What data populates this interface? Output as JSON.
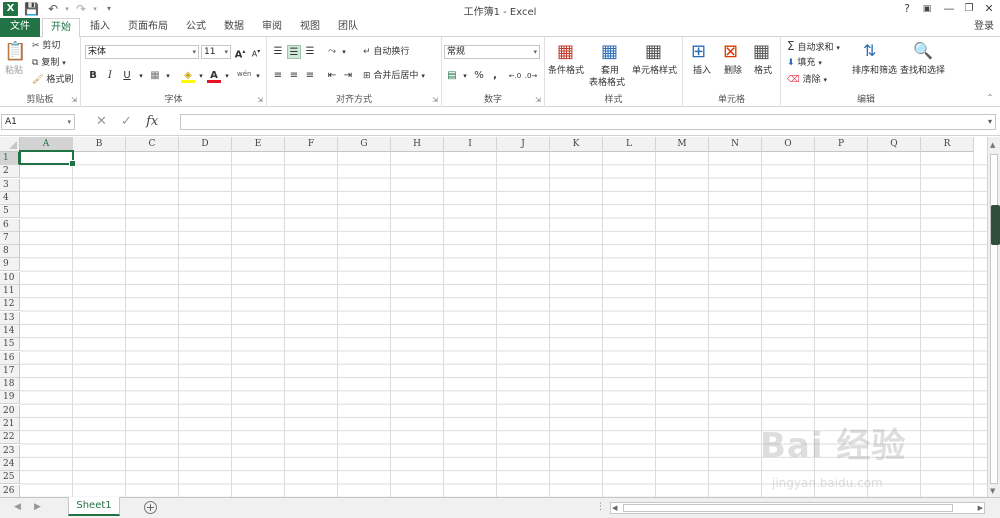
{
  "window": {
    "title": "工作簿1 - Excel",
    "help": "?",
    "login": "登录"
  },
  "tabs": [
    "文件",
    "开始",
    "插入",
    "页面布局",
    "公式",
    "数据",
    "审阅",
    "视图",
    "团队"
  ],
  "clipboard": {
    "paste": "粘贴",
    "cut": "剪切",
    "copy": "复制",
    "format_painter": "格式刷",
    "label": "剪贴板"
  },
  "font": {
    "name": "宋体",
    "size": "11",
    "bold": "B",
    "italic": "I",
    "underline": "U",
    "grow": "A",
    "shrink": "A",
    "color_letter": "A",
    "wen": "wén",
    "label": "字体"
  },
  "alignment": {
    "wrap": "自动换行",
    "merge": "合并后居中",
    "label": "对齐方式"
  },
  "number": {
    "format": "常规",
    "percent": "%",
    "comma": ",",
    "label": "数字"
  },
  "styles": {
    "conditional": "条件格式",
    "table_line1": "套用",
    "table_line2": "表格格式",
    "cell_styles": "单元格样式",
    "label": "样式"
  },
  "cells": {
    "insert": "插入",
    "delete": "删除",
    "format": "格式",
    "label": "单元格"
  },
  "editing": {
    "autosum": "自动求和",
    "fill": "填充",
    "clear": "清除",
    "sort": "排序和筛选",
    "find": "查找和选择",
    "label": "编辑"
  },
  "formula_bar": {
    "name_box": "A1",
    "fx": "fx",
    "value": ""
  },
  "columns": [
    "A",
    "B",
    "C",
    "D",
    "E",
    "F",
    "G",
    "H",
    "I",
    "J",
    "K",
    "L",
    "M",
    "N",
    "O",
    "P",
    "Q",
    "R"
  ],
  "rows": [
    "1",
    "2",
    "3",
    "4",
    "5",
    "6",
    "7",
    "8",
    "9",
    "10",
    "11",
    "12",
    "13",
    "14",
    "15",
    "16",
    "17",
    "18",
    "19",
    "20",
    "21",
    "22",
    "23",
    "24",
    "25",
    "26"
  ],
  "active_cell": "A1",
  "sheets": [
    "Sheet1"
  ],
  "add_sheet": "+",
  "watermark": {
    "main": "Bai 经验",
    "sub": "jingyan.baidu.com"
  },
  "colors": {
    "accent": "#217346",
    "grid": "#dadcdd"
  }
}
